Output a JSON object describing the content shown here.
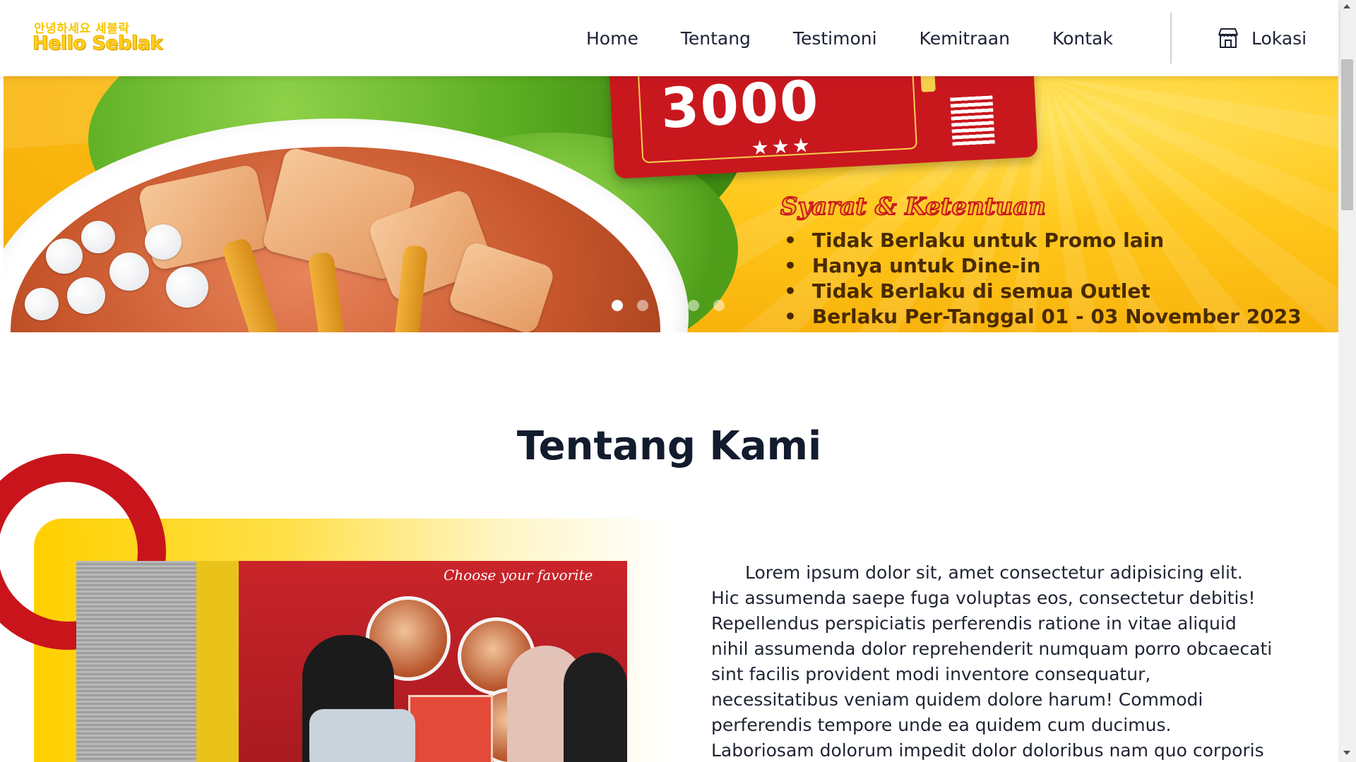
{
  "header": {
    "logo_korean": "안녕하세요 세블락",
    "logo_name": "Hello Seblak",
    "nav": [
      "Home",
      "Tentang",
      "Testimoni",
      "Kemitraan",
      "Kontak"
    ],
    "lokasi_label": "Lokasi",
    "lokasi_icon": "store-icon"
  },
  "banner": {
    "price": "3000",
    "stars": "★★★",
    "terms_title": "Syarat & Ketentuan",
    "terms": [
      "Tidak Berlaku untuk Promo lain",
      "Hanya untuk Dine-in",
      "Tidak Berlaku di semua Outlet",
      "Berlaku Per-Tanggal 01 - 03 November 2023"
    ],
    "slide_count": 5,
    "active_slide": 1
  },
  "about": {
    "title": "Tentang Kami",
    "photo_banner": "Choose your favorite",
    "body": "Lorem ipsum dolor sit, amet consectetur adipisicing elit. Hic assumenda saepe fuga voluptas eos, consectetur debitis! Repellendus perspiciatis perferendis ratione in vitae aliquid nihil assumenda dolor reprehenderit numquam porro obcaecati sint facilis provident modi inventore consequatur, necessitatibus veniam quidem dolore harum! Commodi perferendis tempore unde ea quidem cum ducimus. Laboriosam dolorum impedit dolor doloribus nam quo corporis accusantium."
  },
  "colors": {
    "brand_yellow": "#ffd000",
    "brand_red": "#c9171e",
    "text_dark": "#131b2e"
  }
}
